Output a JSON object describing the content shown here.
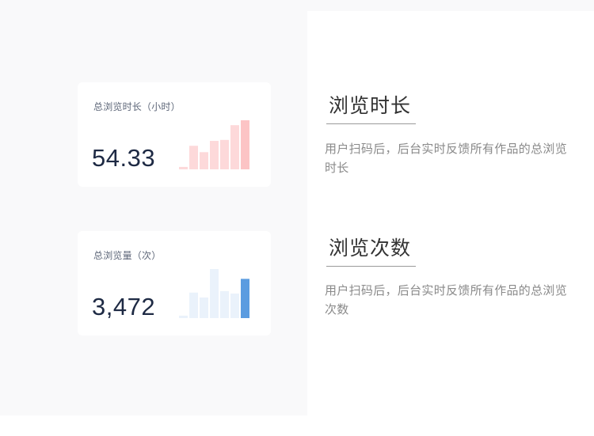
{
  "cards": {
    "duration": {
      "label": "总浏览时长（小时）",
      "value": "54.33",
      "bars": [
        0.05,
        0.48,
        0.35,
        0.58,
        0.6,
        0.9,
        1.0
      ],
      "bar_color": "#fdd9da",
      "highlight_color": "#fcc4c5"
    },
    "views": {
      "label": "总浏览量（次）",
      "value": "3,472",
      "bars": [
        0.05,
        0.52,
        0.42,
        1.0,
        0.55,
        0.5,
        0.8
      ],
      "bar_color": "#eaf2fb",
      "highlight_color": "#5b9ce0"
    }
  },
  "features": {
    "duration": {
      "title": "浏览时长",
      "description": "用户扫码后，后台实时反馈所有作品的总浏览时长"
    },
    "views": {
      "title": "浏览次数",
      "description": "用户扫码后，后台实时反馈所有作品的总浏览次数"
    }
  }
}
